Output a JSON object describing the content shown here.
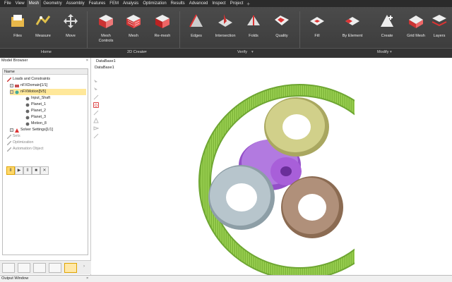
{
  "menu": [
    "File",
    "View",
    "Mesh",
    "Geometry",
    "Assembly",
    "Features",
    "FEM",
    "Analysis",
    "Optimization",
    "Results",
    "Advanced",
    "Inspect",
    "Project"
  ],
  "menu_active": "Mesh",
  "menu_plus": "+",
  "ribbon": {
    "files": "Files",
    "measure": "Measure",
    "move": "Move",
    "mesh_controls": "Mesh\nControls",
    "mesh": "Mesh",
    "remesh": "Re-mesh",
    "edges": "Edges",
    "intersection": "Intersection",
    "folds": "Folds",
    "quality": "Quality",
    "fill": "Fill",
    "by_element": "By Element",
    "create": "Create",
    "grid_mesh": "Grid Mesh",
    "layers": "Layers"
  },
  "groups": {
    "home": "Home",
    "create_2d": "2D Create",
    "verify": "Verify",
    "modify": "Modify"
  },
  "sidebar": {
    "title": "Model Browser",
    "close": "×",
    "column": "Name",
    "items": [
      {
        "label": "Loads and Constraints"
      },
      {
        "label": "nFXDomain[1/1]"
      },
      {
        "label": "nFXMotion[5/5]"
      },
      {
        "label": "Input_Shaft"
      },
      {
        "label": "Planet_1"
      },
      {
        "label": "Planet_2"
      },
      {
        "label": "Planet_3"
      },
      {
        "label": "Motion_8"
      },
      {
        "label": "Solver Settings[1/1]"
      },
      {
        "label": "Sets"
      },
      {
        "label": "Optimization"
      },
      {
        "label": "Automation Object"
      }
    ]
  },
  "playback": {
    "pause": "II",
    "play": "▶",
    "pause2": "II",
    "stop": "■",
    "close": "✕"
  },
  "output": {
    "title": "Output Window",
    "close": "×"
  },
  "viewport": {
    "tab1": "DataBase1",
    "tab2": "DataBase1"
  },
  "colors": {
    "ring": "#8cc63f",
    "sun": "#9b59d0",
    "planet_yellow": "#c8c77a",
    "planet_grey": "#a7b6bd",
    "planet_brown": "#a58468",
    "accent": "#ffd86a"
  }
}
